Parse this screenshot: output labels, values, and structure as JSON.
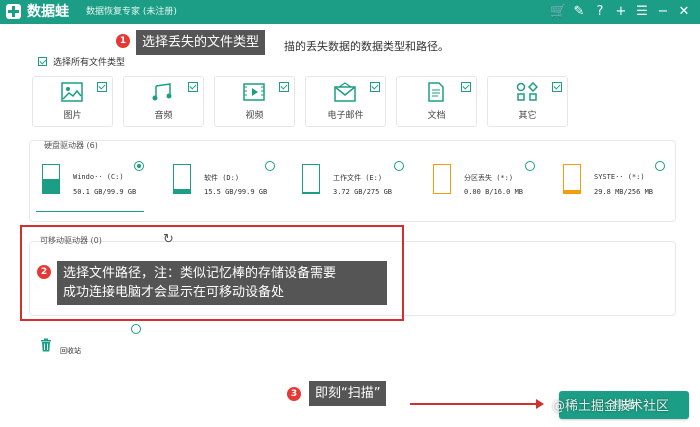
{
  "app": {
    "name": "数据蛙",
    "subtitle": "数据恢复专家 (未注册)"
  },
  "toolbar_icons": [
    "cart-icon",
    "feedback-icon",
    "help-icon",
    "add-icon",
    "menu-icon",
    "minimize-icon",
    "close-icon"
  ],
  "header": {
    "instruction": "描的丢失数据的数据类型和路径。"
  },
  "file_types": {
    "select_all_label": "选择所有文件类型",
    "select_all_checked": true,
    "items": [
      {
        "label": "图片",
        "icon": "image-icon",
        "checked": true
      },
      {
        "label": "音频",
        "icon": "audio-icon",
        "checked": true
      },
      {
        "label": "视频",
        "icon": "video-icon",
        "checked": true
      },
      {
        "label": "电子邮件",
        "icon": "email-icon",
        "checked": true
      },
      {
        "label": "文档",
        "icon": "document-icon",
        "checked": true
      },
      {
        "label": "其它",
        "icon": "other-icon",
        "checked": true
      }
    ]
  },
  "hard_drives": {
    "title": "硬盘驱动器 (6)",
    "items": [
      {
        "name": "Windo·· (C:)",
        "size": "50.1 GB/99.9 GB",
        "fill": 0.5,
        "color": "#1b9e85",
        "selected": true
      },
      {
        "name": "软件 (D:)",
        "size": "15.5 GB/99.9 GB",
        "fill": 0.16,
        "color": "#1b9e85",
        "selected": false
      },
      {
        "name": "工作文件 (E:)",
        "size": "3.72 GB/275 GB",
        "fill": 0.02,
        "color": "#1b9e85",
        "selected": false
      },
      {
        "name": "分区丢失 (*:)",
        "size": "0.00 B/16.0 MB",
        "fill": 0.0,
        "color": "#f39c12",
        "selected": false
      },
      {
        "name": "SYSTE·· (*:)",
        "size": "29.8 MB/256 MB",
        "fill": 0.12,
        "color": "#f39c12",
        "selected": false
      }
    ]
  },
  "removable": {
    "title": "可移动驱动器 (0)"
  },
  "recycle_bin": {
    "label": "回收站"
  },
  "annotations": [
    {
      "number": "1",
      "text": "选择丢失的文件类型"
    },
    {
      "number": "2",
      "text_line1": "选择文件路径，注：类似记忆棒的存储设备需要",
      "text_line2": "成功连接电脑才会显示在可移动设备处"
    },
    {
      "number": "3",
      "text": "即刻“扫描”"
    }
  ],
  "scan_button": {
    "label": "扫描"
  },
  "watermark": "@稀土掘金技术社区",
  "colors": {
    "accent": "#1b9e85",
    "annotation_red": "#d32f2f",
    "callout_bg": "#555555",
    "warning_orange": "#f39c12"
  }
}
